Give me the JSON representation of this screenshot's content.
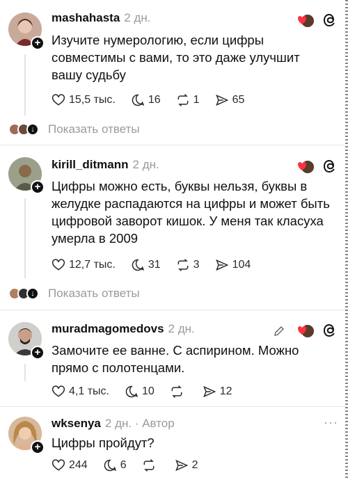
{
  "posts": [
    {
      "username": "mashahasta",
      "time": "2 дн.",
      "text": "Изучите нумерологию, если цифры совместимы с вами, то это даже улучшит вашу судьбу",
      "likes": "15,5 тыс.",
      "comments": "16",
      "reposts": "1",
      "shares": "65",
      "replies_label": "Показать ответы"
    },
    {
      "username": "kirill_ditmann",
      "time": "2 дн.",
      "text": "Цифры можно есть, буквы нельзя, буквы в желудке распадаются на цифры и может быть цифровой заворот кишок. У меня так класуха умерла в 2009",
      "likes": "12,7 тыс.",
      "comments": "31",
      "reposts": "3",
      "shares": "104",
      "replies_label": "Показать ответы"
    },
    {
      "username": "muradmagomedovs",
      "time": "2 дн.",
      "text": "Замочите ее ванне. С аспирином. Можно прямо с полотенцами.",
      "likes": "4,1 тыс.",
      "comments": "10",
      "reposts": "",
      "shares": "12"
    },
    {
      "username": "wksenya",
      "time": "2 дн. · Автор",
      "text": "Цифры пройдут?",
      "likes": "244",
      "comments": "6",
      "reposts": "",
      "shares": "2"
    }
  ],
  "icons": {
    "like": "heart-icon",
    "comment": "comment-icon",
    "repost": "repost-icon",
    "share": "share-icon",
    "threads": "threads-logo-icon",
    "edit": "pencil-icon",
    "more": "more-icon"
  }
}
